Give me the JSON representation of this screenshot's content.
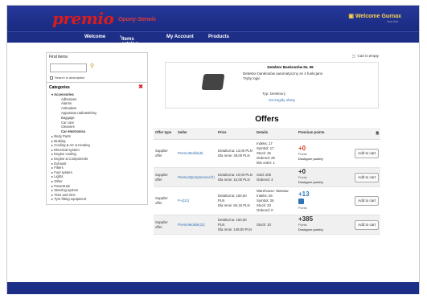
{
  "header": {
    "logo": "premio",
    "logo_sub": "Opony-Serwis",
    "welcome": "Welcome Gurnax",
    "welcome_sub": "Your Info"
  },
  "nav": [
    "Welcome",
    "Items catalog",
    "My Account",
    "Products"
  ],
  "sidebar": {
    "find_title": "Find items",
    "search_placeholder": "",
    "checkbox_label": "Search in description",
    "categories_title": "Categories",
    "categories": [
      {
        "label": "Accessories",
        "expanded": true,
        "sub": [
          "Adhesives",
          "Alarms",
          "Antiradars",
          "Apparatus radiotelefony",
          "Baggage",
          "Car care",
          "Cleaners",
          "Car electronics"
        ]
      },
      {
        "label": "Body Parts"
      },
      {
        "label": "Braking"
      },
      {
        "label": "Cooling & AC & Heating"
      },
      {
        "label": "Electrical system"
      },
      {
        "label": "Engine cooling"
      },
      {
        "label": "Engine & Components"
      },
      {
        "label": "Exhaust"
      },
      {
        "label": "Filters"
      },
      {
        "label": "Fuel system"
      },
      {
        "label": "Lights"
      },
      {
        "label": "Other"
      },
      {
        "label": "Powertrain"
      },
      {
        "label": "Steering system"
      },
      {
        "label": "Tires and rims"
      },
      {
        "label": "Tyre fitting equipment"
      }
    ]
  },
  "main": {
    "cart_link": "Cart is empty",
    "product": {
      "name": "Detektor Banknotów DL 06",
      "desc": "Detektor banknotów automatyczny ze 4 funkcjami",
      "desc2": "Tryby logic",
      "type": "Typ: Detektory",
      "more": "Szczegóły oferty"
    },
    "offers_title": "Offers",
    "columns": [
      "Offer type",
      "Seller",
      "Price",
      "Details",
      "Premium points",
      ""
    ],
    "offers": [
      {
        "type": "Supplier offer",
        "seller": "PremioMobile(9)",
        "price": [
          "Detaliczna: 13,00 PLN",
          "Dla mnie: 49,00 PLN"
        ],
        "details": [
          "Indeks: 17",
          "Symbol: 17",
          "Stock: 25",
          "Ordered: 25",
          "Min order: 1"
        ],
        "points": "+0",
        "points_label": "Points",
        "points_sub": "Dostępne punkty",
        "points_style": "red",
        "button": "Add to cart"
      },
      {
        "type": "Supplier offer",
        "seller": "PremioOponyService(7)",
        "price": [
          "Detaliczna: 10,00 PLN",
          "Dla mnie: 10,00 PLN"
        ],
        "details": [
          "Sold: 200",
          "Ordered: 4"
        ],
        "points": "+0",
        "points_label": "Points",
        "points_sub": "Dostępne punkty",
        "points_style": "gray",
        "button": "Add to cart"
      },
      {
        "type": "Supplier offer",
        "seller": "P-4(21)",
        "price": [
          "Detaliczna: 100,00 PLN",
          "Dla mnie: 84,15 PLN"
        ],
        "details": [
          "Warehouse: Warsaw",
          "Indeks: 26",
          "Symbol: 26",
          "Stock: 33",
          "Ordered: 0"
        ],
        "points": "+13",
        "points_label": "Points",
        "points_sub": "",
        "points_style": "blue",
        "button": "Add to cart"
      },
      {
        "type": "Supplier offer",
        "seller": "PremioMobile(11)",
        "price": [
          "Detaliczna: 150,00 PLN",
          "Dla mnie: 149,00 PLN"
        ],
        "details": [
          "Stock: 10"
        ],
        "points": "+385",
        "points_label": "Points",
        "points_sub": "Dostępne punkty",
        "points_style": "dark",
        "button": "Add to cart"
      }
    ]
  }
}
